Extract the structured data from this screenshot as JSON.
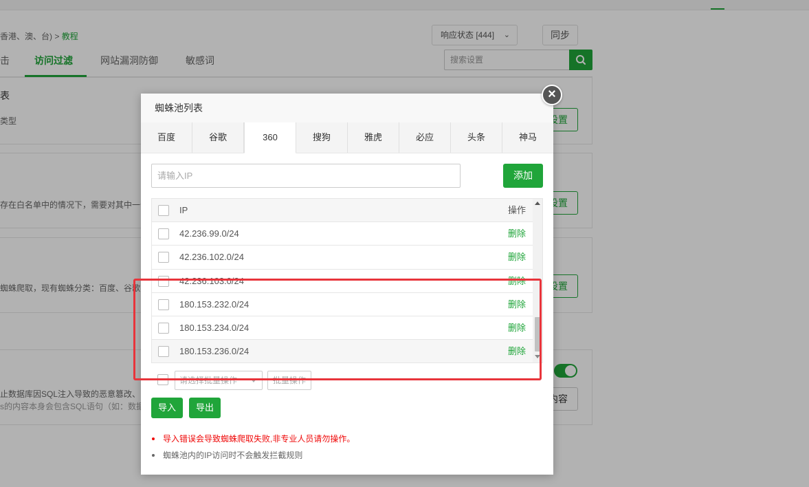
{
  "background": {
    "breadcrumb_prefix": "香港、澳、台)",
    "breadcrumb_sep": " > ",
    "breadcrumb_link": "教程",
    "status_select": "响应状态 [444]",
    "sync_button": "同步",
    "tabs": [
      "击",
      "访问过滤",
      "网站漏洞防御",
      "敏感词"
    ],
    "active_tab": "访问过滤",
    "search_placeholder": "搜索设置",
    "card1_title": "表",
    "card1_desc": "类型",
    "card2_desc": "存在白名单中的情况下，需要对其中一个",
    "card3_desc": "蜘蛛爬取，现有蜘蛛分类：百度、谷歌",
    "card4_desc1": "止数据库因SQL注入导致的恶意篡改、",
    "card4_desc2": "s的内容本身会包含SQL语句（如：数据",
    "settings_button": "设置",
    "content_button": "内容"
  },
  "modal": {
    "title": "蜘蛛池列表",
    "tabs": [
      "百度",
      "谷歌",
      "360",
      "搜狗",
      "雅虎",
      "必应",
      "头条",
      "神马"
    ],
    "active_tab": "360",
    "ip_placeholder": "请输入IP",
    "add_button": "添加",
    "table": {
      "col_ip": "IP",
      "col_op": "操作",
      "rows": [
        {
          "ip": "42.236.99.0/24",
          "op": "删除"
        },
        {
          "ip": "42.236.102.0/24",
          "op": "删除"
        },
        {
          "ip": "42.236.103.0/24",
          "op": "删除"
        },
        {
          "ip": "180.153.232.0/24",
          "op": "删除"
        },
        {
          "ip": "180.153.234.0/24",
          "op": "删除"
        },
        {
          "ip": "180.153.236.0/24",
          "op": "删除"
        }
      ]
    },
    "batch_placeholder": "请选择批量操作",
    "batch_button": "批量操作",
    "import_button": "导入",
    "export_button": "导出",
    "notes": [
      "导入错误会导致蜘蛛爬取失败,非专业人员请勿操作。",
      "蜘蛛池内的IP访问时不会触发拦截规则"
    ]
  },
  "colors": {
    "accent": "#20a53a",
    "warning": "#ef0808",
    "highlight": "#e8343b"
  }
}
